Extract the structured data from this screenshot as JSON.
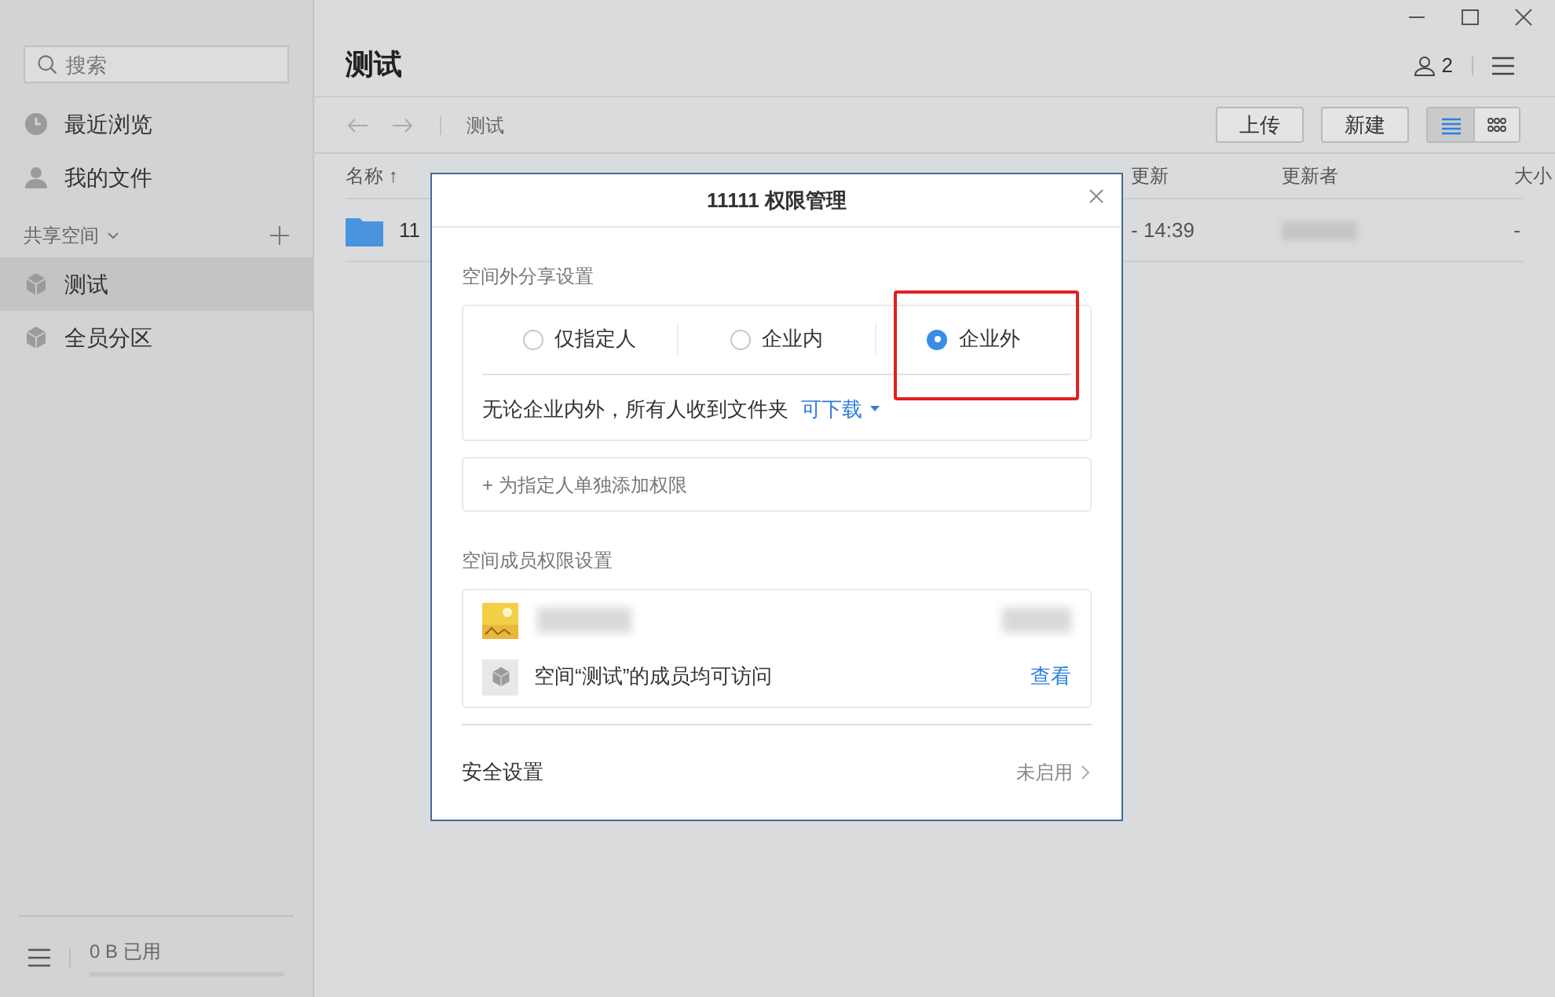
{
  "sidebar": {
    "search": {
      "placeholder": "搜索"
    },
    "items": [
      {
        "label": "最近浏览",
        "kind": "clock",
        "selected": false
      },
      {
        "label": "我的文件",
        "kind": "person",
        "selected": false
      }
    ],
    "section": {
      "label": "共享空间"
    },
    "spaces": [
      {
        "label": "测试",
        "selected": true
      },
      {
        "label": "全员分区",
        "selected": false
      }
    ],
    "storage": {
      "reading": "0 B 已用",
      "level": 0
    }
  },
  "header": {
    "title": "测试",
    "members": "2"
  },
  "toolbar": {
    "breadcrumb": "测试",
    "buttons": [
      "上传",
      "新建"
    ],
    "views": [
      {
        "kind": "list",
        "selected": true
      },
      {
        "kind": "grid",
        "selected": false
      }
    ]
  },
  "table": {
    "columns": [
      "名称 ↑",
      "更新",
      "更新者",
      "大小"
    ],
    "rows": [
      {
        "name": "11",
        "updated": "- 14:39",
        "size": "-"
      }
    ]
  },
  "dialog": {
    "title": "11111 权限管理",
    "share_section": "空间外分享设置",
    "options": [
      {
        "label": "仅指定人",
        "selected": false
      },
      {
        "label": "企业内",
        "selected": false
      },
      {
        "label": "企业外",
        "selected": true
      }
    ],
    "description": "无论企业内外，所有人收到文件夹",
    "permission": "可下载",
    "add_button": "+ 为指定人单独添加权限",
    "members_section": "空间成员权限设置",
    "member_note": "空间“测试”的成员均可访问",
    "view_link": "查看",
    "security": {
      "label": "安全设置",
      "status": "未启用"
    }
  }
}
